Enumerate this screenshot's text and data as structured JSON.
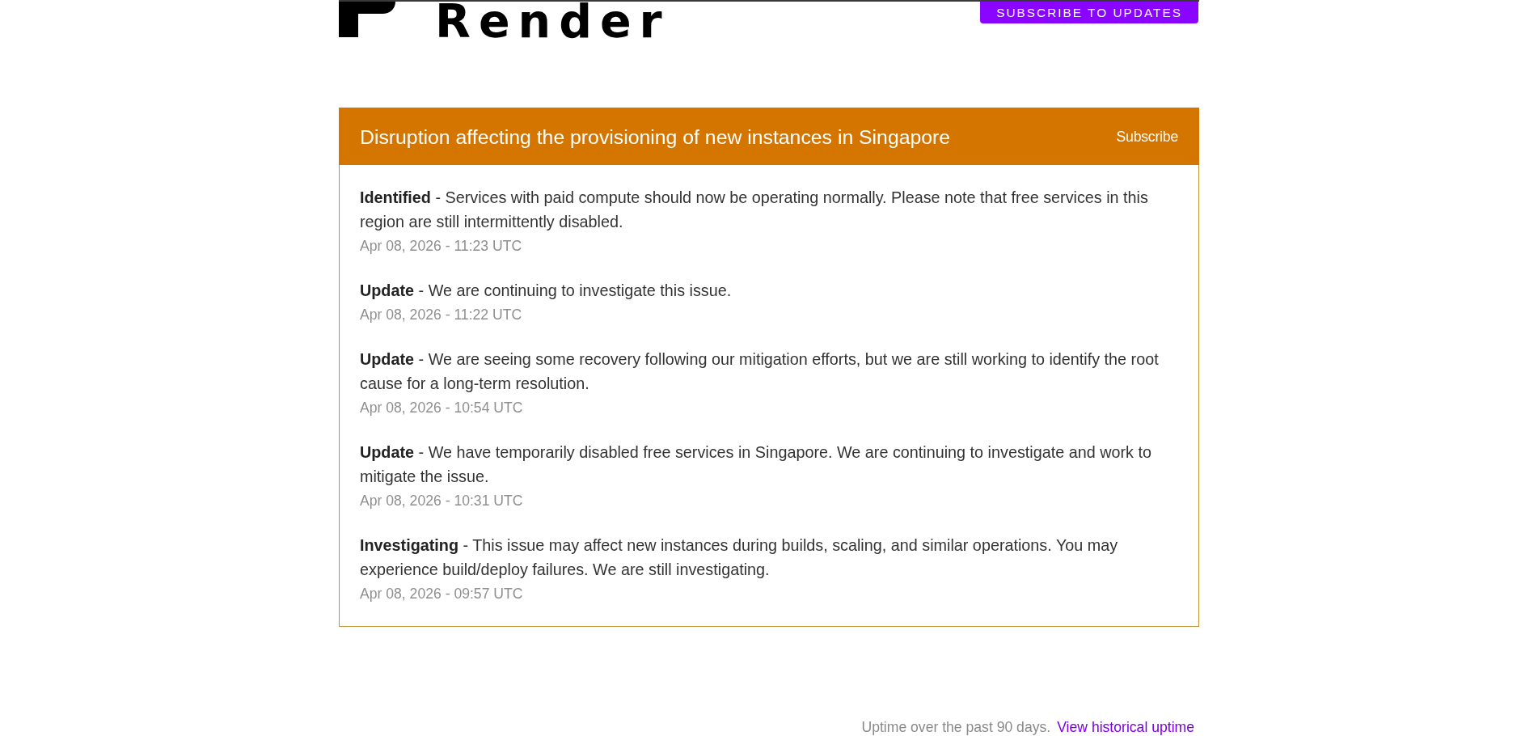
{
  "logo": {
    "text": "Render"
  },
  "header": {
    "subscribe_button": "SUBSCRIBE TO UPDATES"
  },
  "incident": {
    "title": "Disruption affecting the provisioning of new instances in Singapore",
    "subscribe_link": "Subscribe",
    "updates": [
      {
        "text": "**Identified** - Services with paid compute should now be operating normally. Please note that free services in this region are still intermittently disabled.",
        "timestamp": "Apr 08, 2026 - 11:23 UTC"
      },
      {
        "text": "**Update** - We are continuing to investigate this issue.",
        "timestamp": "Apr 08, 2026 - 11:22 UTC"
      },
      {
        "text": "**Update** - We are seeing some recovery following our mitigation efforts, but we are still working to identify the root cause for a long-term resolution.",
        "timestamp": "Apr 08, 2026 - 10:54 UTC"
      },
      {
        "text": "**Update** - We have temporarily disabled free services in Singapore. We are continuing to investigate and work to mitigate the issue.",
        "timestamp": "Apr 08, 2026 - 10:31 UTC"
      },
      {
        "text": "**Investigating** - This issue may affect new instances during builds, scaling, and similar operations. You may experience build/deploy failures. We are still investigating.",
        "timestamp": "Apr 08, 2026 - 09:57 UTC"
      }
    ]
  },
  "uptime": {
    "caption": "Uptime over the past 90 days.",
    "link": "View historical uptime"
  }
}
